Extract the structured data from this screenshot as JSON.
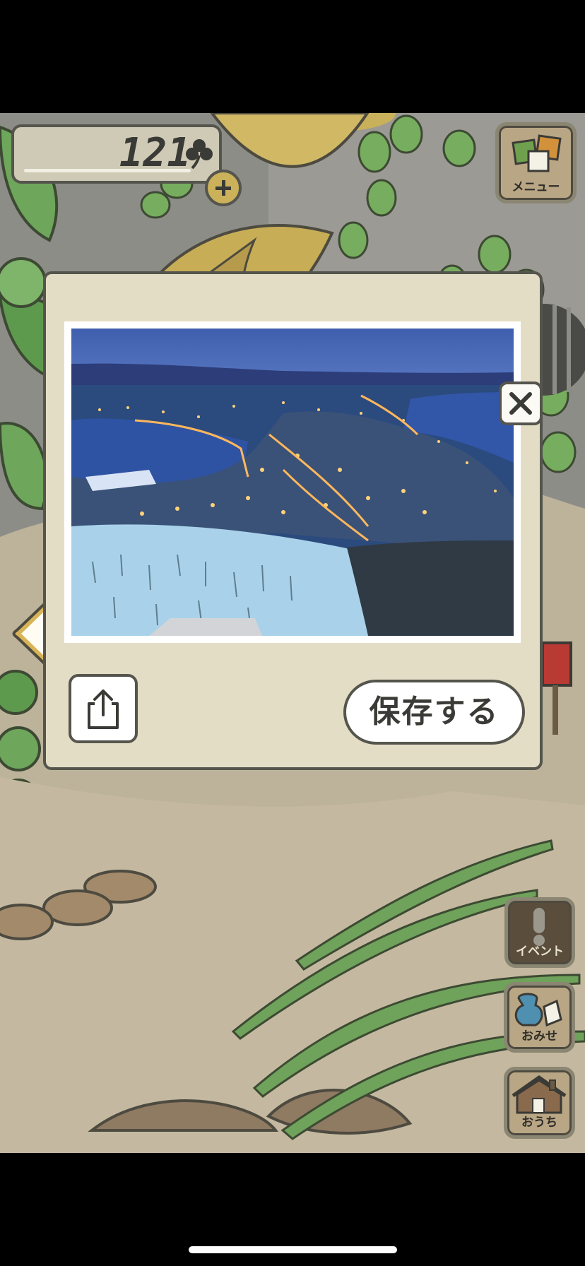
{
  "counter": {
    "value": "121",
    "icon": "clover-icon"
  },
  "buttons": {
    "menu_label": "メニュー",
    "event_label": "イベント",
    "shop_label": "おみせ",
    "home_label": "おうち"
  },
  "dialog": {
    "save_label": "保存する",
    "close_icon": "close-icon",
    "share_icon": "share-icon"
  },
  "colors": {
    "dialog_bg": "#e4ddc5",
    "outline": "#55554e",
    "photo_sky": "#3f5fa8",
    "ground": "#bdb39a"
  }
}
